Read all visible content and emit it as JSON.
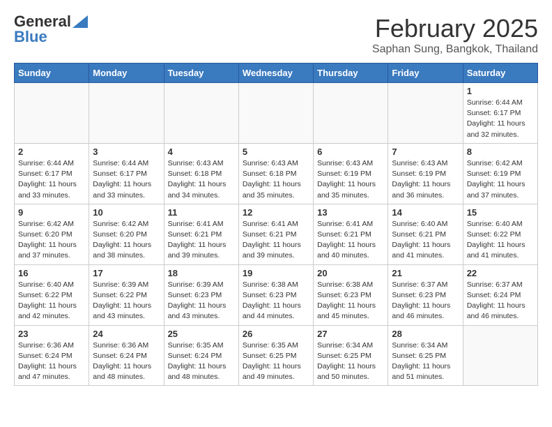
{
  "header": {
    "logo_general": "General",
    "logo_blue": "Blue",
    "month": "February 2025",
    "location": "Saphan Sung, Bangkok, Thailand"
  },
  "weekdays": [
    "Sunday",
    "Monday",
    "Tuesday",
    "Wednesday",
    "Thursday",
    "Friday",
    "Saturday"
  ],
  "weeks": [
    [
      {
        "day": "",
        "info": ""
      },
      {
        "day": "",
        "info": ""
      },
      {
        "day": "",
        "info": ""
      },
      {
        "day": "",
        "info": ""
      },
      {
        "day": "",
        "info": ""
      },
      {
        "day": "",
        "info": ""
      },
      {
        "day": "1",
        "info": "Sunrise: 6:44 AM\nSunset: 6:17 PM\nDaylight: 11 hours\nand 32 minutes."
      }
    ],
    [
      {
        "day": "2",
        "info": "Sunrise: 6:44 AM\nSunset: 6:17 PM\nDaylight: 11 hours\nand 33 minutes."
      },
      {
        "day": "3",
        "info": "Sunrise: 6:44 AM\nSunset: 6:17 PM\nDaylight: 11 hours\nand 33 minutes."
      },
      {
        "day": "4",
        "info": "Sunrise: 6:43 AM\nSunset: 6:18 PM\nDaylight: 11 hours\nand 34 minutes."
      },
      {
        "day": "5",
        "info": "Sunrise: 6:43 AM\nSunset: 6:18 PM\nDaylight: 11 hours\nand 35 minutes."
      },
      {
        "day": "6",
        "info": "Sunrise: 6:43 AM\nSunset: 6:19 PM\nDaylight: 11 hours\nand 35 minutes."
      },
      {
        "day": "7",
        "info": "Sunrise: 6:43 AM\nSunset: 6:19 PM\nDaylight: 11 hours\nand 36 minutes."
      },
      {
        "day": "8",
        "info": "Sunrise: 6:42 AM\nSunset: 6:19 PM\nDaylight: 11 hours\nand 37 minutes."
      }
    ],
    [
      {
        "day": "9",
        "info": "Sunrise: 6:42 AM\nSunset: 6:20 PM\nDaylight: 11 hours\nand 37 minutes."
      },
      {
        "day": "10",
        "info": "Sunrise: 6:42 AM\nSunset: 6:20 PM\nDaylight: 11 hours\nand 38 minutes."
      },
      {
        "day": "11",
        "info": "Sunrise: 6:41 AM\nSunset: 6:21 PM\nDaylight: 11 hours\nand 39 minutes."
      },
      {
        "day": "12",
        "info": "Sunrise: 6:41 AM\nSunset: 6:21 PM\nDaylight: 11 hours\nand 39 minutes."
      },
      {
        "day": "13",
        "info": "Sunrise: 6:41 AM\nSunset: 6:21 PM\nDaylight: 11 hours\nand 40 minutes."
      },
      {
        "day": "14",
        "info": "Sunrise: 6:40 AM\nSunset: 6:21 PM\nDaylight: 11 hours\nand 41 minutes."
      },
      {
        "day": "15",
        "info": "Sunrise: 6:40 AM\nSunset: 6:22 PM\nDaylight: 11 hours\nand 41 minutes."
      }
    ],
    [
      {
        "day": "16",
        "info": "Sunrise: 6:40 AM\nSunset: 6:22 PM\nDaylight: 11 hours\nand 42 minutes."
      },
      {
        "day": "17",
        "info": "Sunrise: 6:39 AM\nSunset: 6:22 PM\nDaylight: 11 hours\nand 43 minutes."
      },
      {
        "day": "18",
        "info": "Sunrise: 6:39 AM\nSunset: 6:23 PM\nDaylight: 11 hours\nand 43 minutes."
      },
      {
        "day": "19",
        "info": "Sunrise: 6:38 AM\nSunset: 6:23 PM\nDaylight: 11 hours\nand 44 minutes."
      },
      {
        "day": "20",
        "info": "Sunrise: 6:38 AM\nSunset: 6:23 PM\nDaylight: 11 hours\nand 45 minutes."
      },
      {
        "day": "21",
        "info": "Sunrise: 6:37 AM\nSunset: 6:23 PM\nDaylight: 11 hours\nand 46 minutes."
      },
      {
        "day": "22",
        "info": "Sunrise: 6:37 AM\nSunset: 6:24 PM\nDaylight: 11 hours\nand 46 minutes."
      }
    ],
    [
      {
        "day": "23",
        "info": "Sunrise: 6:36 AM\nSunset: 6:24 PM\nDaylight: 11 hours\nand 47 minutes."
      },
      {
        "day": "24",
        "info": "Sunrise: 6:36 AM\nSunset: 6:24 PM\nDaylight: 11 hours\nand 48 minutes."
      },
      {
        "day": "25",
        "info": "Sunrise: 6:35 AM\nSunset: 6:24 PM\nDaylight: 11 hours\nand 48 minutes."
      },
      {
        "day": "26",
        "info": "Sunrise: 6:35 AM\nSunset: 6:25 PM\nDaylight: 11 hours\nand 49 minutes."
      },
      {
        "day": "27",
        "info": "Sunrise: 6:34 AM\nSunset: 6:25 PM\nDaylight: 11 hours\nand 50 minutes."
      },
      {
        "day": "28",
        "info": "Sunrise: 6:34 AM\nSunset: 6:25 PM\nDaylight: 11 hours\nand 51 minutes."
      },
      {
        "day": "",
        "info": ""
      }
    ]
  ]
}
